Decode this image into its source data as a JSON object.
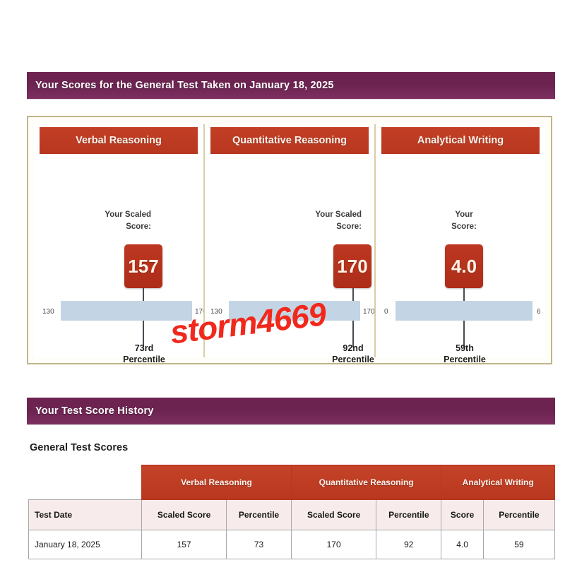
{
  "sections": {
    "scores_banner": "Your Scores for the General Test Taken on January 18, 2025",
    "history_banner": "Your Test Score History",
    "history_subtitle": "General Test Scores"
  },
  "score_cards": [
    {
      "title": "Verbal Reasoning",
      "score_label": "Your Scaled\nScore:",
      "score": "157",
      "range_min": "130",
      "range_max": "170",
      "percentile": "73rd\nPercentile"
    },
    {
      "title": "Quantitative Reasoning",
      "score_label": "Your Scaled\nScore:",
      "score": "170",
      "range_min": "130",
      "range_max": "170",
      "percentile": "92nd\nPercentile"
    },
    {
      "title": "Analytical Writing",
      "score_label": "Your\nScore:",
      "score": "4.0",
      "range_min": "0",
      "range_max": "6",
      "percentile": "59th\nPercentile"
    }
  ],
  "history_table": {
    "group_headers": [
      "Verbal Reasoning",
      "Quantitative Reasoning",
      "Analytical Writing"
    ],
    "sub_headers": [
      "Test Date",
      "Scaled Score",
      "Percentile",
      "Scaled Score",
      "Percentile",
      "Score",
      "Percentile"
    ],
    "rows": [
      [
        "January 18, 2025",
        "157",
        "73",
        "170",
        "92",
        "4.0",
        "59"
      ]
    ]
  },
  "watermark": "storm4669",
  "colors": {
    "banner_purple": "#6b2350",
    "header_red": "#bf3c22",
    "chip_red": "#b8331f",
    "range_bar_blue": "#c3d5e4",
    "panel_border": "#bfb58a",
    "watermark_red": "#f0291c"
  }
}
